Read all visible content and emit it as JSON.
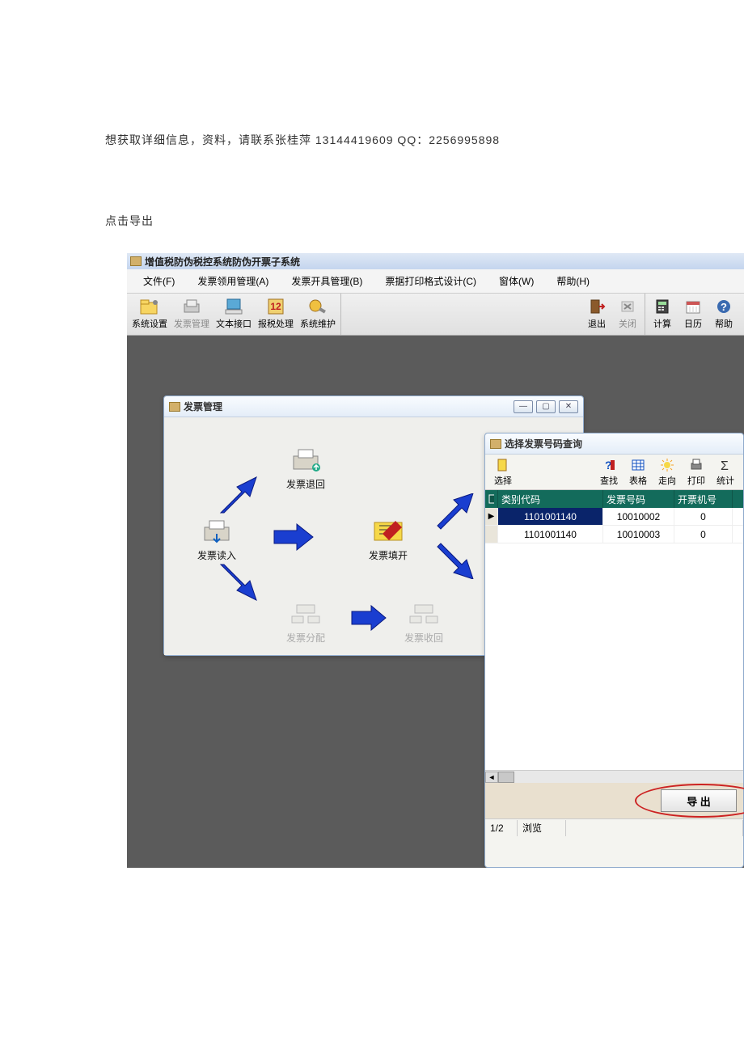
{
  "doc": {
    "line1": "想获取详细信息，资料，请联系张桂萍 13144419609   QQ：2256995898",
    "line2": "点击导出"
  },
  "app": {
    "title": "增值税防伪税控系统防伪开票子系统",
    "menu": {
      "file": "文件(F)",
      "invoice_receive": "发票领用管理(A)",
      "invoice_issue": "发票开具管理(B)",
      "print_format": "票据打印格式设计(C)",
      "window": "窗体(W)",
      "help": "帮助(H)"
    },
    "toolbar": {
      "sys_setting": "系统设置",
      "invoice_mgmt": "发票管理",
      "text_interface": "文本接口",
      "tax_report": "报税处理",
      "sys_maintain": "系统维护",
      "exit": "退出",
      "close": "关闭",
      "calc": "计算",
      "calendar": "日历",
      "help": "帮助"
    },
    "inv_win": {
      "title": "发票管理",
      "nodes": {
        "return": "发票退回",
        "read": "发票读入",
        "fill": "发票填开",
        "distribute": "发票分配",
        "recover": "发票收回"
      }
    },
    "sel_win": {
      "title": "选择发票号码查询",
      "toolbar": {
        "select": "选择",
        "search": "查找",
        "table": "表格",
        "orient": "走向",
        "print": "打印",
        "stats": "统计"
      },
      "grid": {
        "headers": {
          "code": "类别代码",
          "number": "发票号码",
          "machine": "开票机号"
        },
        "rows": [
          {
            "code": "1101001140",
            "number": "10010002",
            "machine": "0",
            "selected": true
          },
          {
            "code": "1101001140",
            "number": "10010003",
            "machine": "0",
            "selected": false
          }
        ]
      },
      "export_btn": "导 出",
      "status": {
        "page": "1/2",
        "mode": "浏览"
      }
    }
  }
}
